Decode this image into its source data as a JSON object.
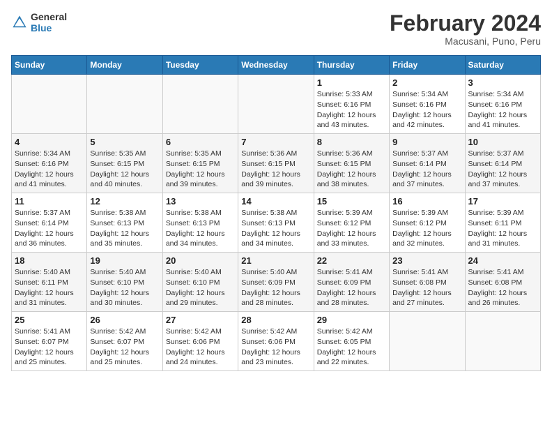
{
  "header": {
    "logo_general": "General",
    "logo_blue": "Blue",
    "month": "February 2024",
    "location": "Macusani, Puno, Peru"
  },
  "weekdays": [
    "Sunday",
    "Monday",
    "Tuesday",
    "Wednesday",
    "Thursday",
    "Friday",
    "Saturday"
  ],
  "weeks": [
    [
      {
        "day": "",
        "info": ""
      },
      {
        "day": "",
        "info": ""
      },
      {
        "day": "",
        "info": ""
      },
      {
        "day": "",
        "info": ""
      },
      {
        "day": "1",
        "info": "Sunrise: 5:33 AM\nSunset: 6:16 PM\nDaylight: 12 hours\nand 43 minutes."
      },
      {
        "day": "2",
        "info": "Sunrise: 5:34 AM\nSunset: 6:16 PM\nDaylight: 12 hours\nand 42 minutes."
      },
      {
        "day": "3",
        "info": "Sunrise: 5:34 AM\nSunset: 6:16 PM\nDaylight: 12 hours\nand 41 minutes."
      }
    ],
    [
      {
        "day": "4",
        "info": "Sunrise: 5:34 AM\nSunset: 6:16 PM\nDaylight: 12 hours\nand 41 minutes."
      },
      {
        "day": "5",
        "info": "Sunrise: 5:35 AM\nSunset: 6:15 PM\nDaylight: 12 hours\nand 40 minutes."
      },
      {
        "day": "6",
        "info": "Sunrise: 5:35 AM\nSunset: 6:15 PM\nDaylight: 12 hours\nand 39 minutes."
      },
      {
        "day": "7",
        "info": "Sunrise: 5:36 AM\nSunset: 6:15 PM\nDaylight: 12 hours\nand 39 minutes."
      },
      {
        "day": "8",
        "info": "Sunrise: 5:36 AM\nSunset: 6:15 PM\nDaylight: 12 hours\nand 38 minutes."
      },
      {
        "day": "9",
        "info": "Sunrise: 5:37 AM\nSunset: 6:14 PM\nDaylight: 12 hours\nand 37 minutes."
      },
      {
        "day": "10",
        "info": "Sunrise: 5:37 AM\nSunset: 6:14 PM\nDaylight: 12 hours\nand 37 minutes."
      }
    ],
    [
      {
        "day": "11",
        "info": "Sunrise: 5:37 AM\nSunset: 6:14 PM\nDaylight: 12 hours\nand 36 minutes."
      },
      {
        "day": "12",
        "info": "Sunrise: 5:38 AM\nSunset: 6:13 PM\nDaylight: 12 hours\nand 35 minutes."
      },
      {
        "day": "13",
        "info": "Sunrise: 5:38 AM\nSunset: 6:13 PM\nDaylight: 12 hours\nand 34 minutes."
      },
      {
        "day": "14",
        "info": "Sunrise: 5:38 AM\nSunset: 6:13 PM\nDaylight: 12 hours\nand 34 minutes."
      },
      {
        "day": "15",
        "info": "Sunrise: 5:39 AM\nSunset: 6:12 PM\nDaylight: 12 hours\nand 33 minutes."
      },
      {
        "day": "16",
        "info": "Sunrise: 5:39 AM\nSunset: 6:12 PM\nDaylight: 12 hours\nand 32 minutes."
      },
      {
        "day": "17",
        "info": "Sunrise: 5:39 AM\nSunset: 6:11 PM\nDaylight: 12 hours\nand 31 minutes."
      }
    ],
    [
      {
        "day": "18",
        "info": "Sunrise: 5:40 AM\nSunset: 6:11 PM\nDaylight: 12 hours\nand 31 minutes."
      },
      {
        "day": "19",
        "info": "Sunrise: 5:40 AM\nSunset: 6:10 PM\nDaylight: 12 hours\nand 30 minutes."
      },
      {
        "day": "20",
        "info": "Sunrise: 5:40 AM\nSunset: 6:10 PM\nDaylight: 12 hours\nand 29 minutes."
      },
      {
        "day": "21",
        "info": "Sunrise: 5:40 AM\nSunset: 6:09 PM\nDaylight: 12 hours\nand 28 minutes."
      },
      {
        "day": "22",
        "info": "Sunrise: 5:41 AM\nSunset: 6:09 PM\nDaylight: 12 hours\nand 28 minutes."
      },
      {
        "day": "23",
        "info": "Sunrise: 5:41 AM\nSunset: 6:08 PM\nDaylight: 12 hours\nand 27 minutes."
      },
      {
        "day": "24",
        "info": "Sunrise: 5:41 AM\nSunset: 6:08 PM\nDaylight: 12 hours\nand 26 minutes."
      }
    ],
    [
      {
        "day": "25",
        "info": "Sunrise: 5:41 AM\nSunset: 6:07 PM\nDaylight: 12 hours\nand 25 minutes."
      },
      {
        "day": "26",
        "info": "Sunrise: 5:42 AM\nSunset: 6:07 PM\nDaylight: 12 hours\nand 25 minutes."
      },
      {
        "day": "27",
        "info": "Sunrise: 5:42 AM\nSunset: 6:06 PM\nDaylight: 12 hours\nand 24 minutes."
      },
      {
        "day": "28",
        "info": "Sunrise: 5:42 AM\nSunset: 6:06 PM\nDaylight: 12 hours\nand 23 minutes."
      },
      {
        "day": "29",
        "info": "Sunrise: 5:42 AM\nSunset: 6:05 PM\nDaylight: 12 hours\nand 22 minutes."
      },
      {
        "day": "",
        "info": ""
      },
      {
        "day": "",
        "info": ""
      }
    ]
  ]
}
